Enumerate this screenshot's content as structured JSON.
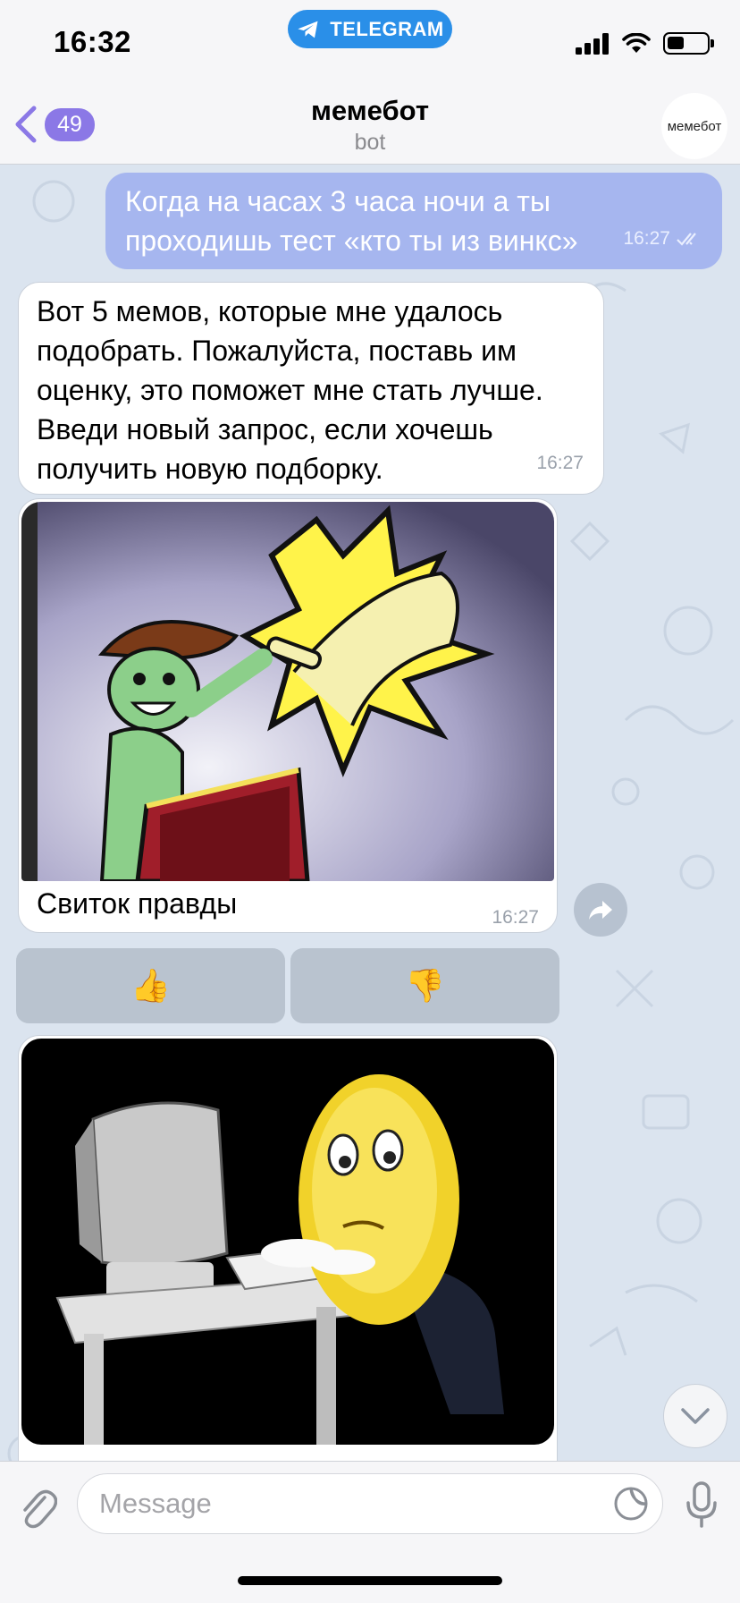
{
  "status_bar": {
    "time": "16:32",
    "telegram_pill": "TELEGRAM"
  },
  "header": {
    "back_count": "49",
    "title": "мемебот",
    "subtitle": "bot",
    "avatar_text": "мемебот"
  },
  "messages": {
    "outgoing": {
      "text": "Когда на часах 3 часа ночи а ты проходишь тест «кто ты из винкс»",
      "time": "16:27"
    },
    "incoming_text": {
      "text": "Вот 5 мемов, которые мне удалось подобрать. Пожалуйста, поставь им оценку, это поможет мне стать лучше. Введи новый запрос, если хочешь получить новую подборку.",
      "time": "16:27"
    },
    "photo1": {
      "caption": "Свиток правды",
      "time": "16:27"
    }
  },
  "keyboard": {
    "like": "👍",
    "dislike": "👎"
  },
  "input": {
    "placeholder": "Message"
  },
  "colors": {
    "outgoing_bubble": "#a6b6ef",
    "badge": "#8b78e6",
    "telegram_pill": "#2a8fe8",
    "chat_bg": "#dbe4ef"
  },
  "icons": [
    "telegram-icon",
    "signal-icon",
    "wifi-icon",
    "battery-icon",
    "chevron-left-icon",
    "double-check-icon",
    "share-arrow-icon",
    "chevron-down-icon",
    "paperclip-icon",
    "sticker-icon",
    "microphone-icon"
  ]
}
